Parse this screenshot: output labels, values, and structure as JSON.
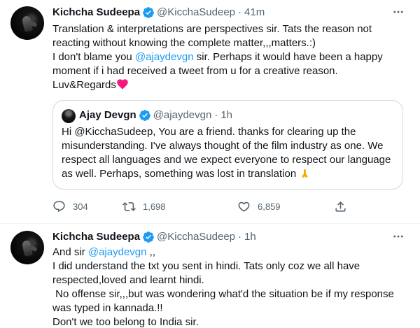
{
  "tweet1": {
    "author_name": "Kichcha Sudeepa",
    "handle": "@KicchaSudeep",
    "separator": "·",
    "time": "41m",
    "lines": [
      "Translation & interpretations are perspectives sir. Tats the reason not",
      "reacting without knowing the complete matter,,,matters.:)"
    ],
    "line3_prefix": "I don't blame you ",
    "line3_mention": "@ajaydevgn",
    "line3_suffix": " sir. Perhaps it would have been a happy",
    "line4": "moment if i had received a tweet from u for a creative reason.",
    "line5": "Luv&Regards",
    "quote": {
      "author_name": "Ajay Devgn",
      "handle": "@ajaydevgn",
      "separator": "·",
      "time": "1h",
      "lines": [
        "Hi @KicchaSudeep, You are a friend. thanks for clearing up the",
        "misunderstanding.  I've always thought of the film industry as one.  We",
        "respect all languages and we expect everyone to respect our language",
        "as well. Perhaps, something was lost in translation "
      ]
    },
    "actions": {
      "replies": "304",
      "retweets": "1,698",
      "likes": "6,859"
    }
  },
  "tweet2": {
    "author_name": "Kichcha Sudeepa",
    "handle": "@KicchaSudeep",
    "separator": "·",
    "time": "1h",
    "line1_prefix": "And sir ",
    "line1_mention": "@ajaydevgn",
    "line1_suffix": " ,,",
    "lines": [
      "I did understand the txt you sent in hindi. Tats only coz we all have",
      "respected,loved and learnt hindi.",
      " No offense sir,,,but was wondering what'd the situation be if my response",
      "was typed in kannada.!!",
      "Don't we too belong to India sir."
    ]
  },
  "colors": {
    "accent": "#1d9bf0",
    "text": "#0f1419",
    "secondary": "#536471",
    "border": "#cfd9de",
    "heart": "#f91880"
  },
  "icons": [
    "verified-badge-icon",
    "more-options-icon",
    "reply-icon",
    "retweet-icon",
    "like-icon",
    "share-icon",
    "heart-emoji-icon",
    "folded-hands-emoji-icon"
  ]
}
